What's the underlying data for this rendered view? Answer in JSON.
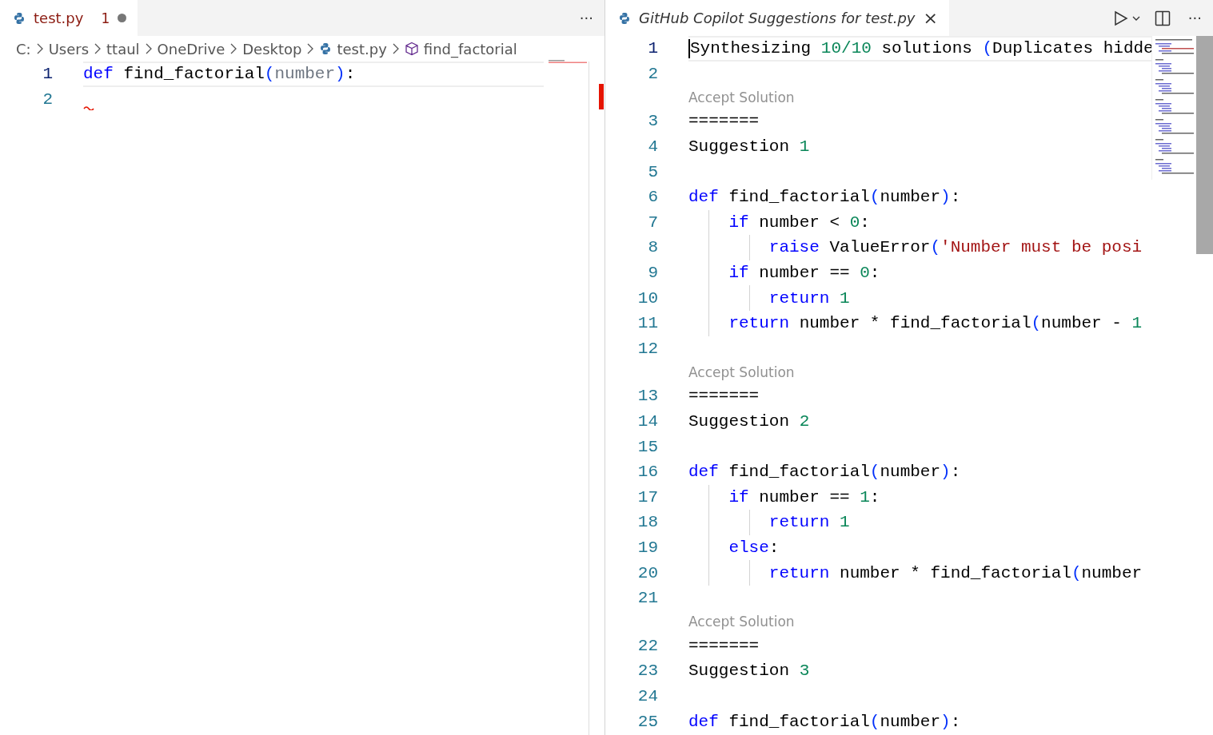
{
  "left_editor": {
    "tab": {
      "label": "test.py",
      "problems": "1",
      "dirty": true,
      "selected": true
    },
    "more_actions": "···",
    "breadcrumbs": [
      {
        "label": "C:",
        "kind": "plain"
      },
      {
        "label": "Users",
        "kind": "plain"
      },
      {
        "label": "ttaul",
        "kind": "plain"
      },
      {
        "label": "OneDrive",
        "kind": "plain"
      },
      {
        "label": "Desktop",
        "kind": "plain"
      },
      {
        "label": "test.py",
        "kind": "file"
      },
      {
        "label": "find_factorial",
        "kind": "symbol"
      }
    ],
    "lines": [
      {
        "number": "1",
        "current": true,
        "error": false,
        "tokens": [
          {
            "text": "def",
            "kind": "kw"
          },
          {
            "text": " find_factorial",
            "kind": "plain"
          },
          {
            "text": "(",
            "kind": "paren"
          },
          {
            "text": "number",
            "kind": "param"
          },
          {
            "text": ")",
            "kind": "paren"
          },
          {
            "text": ":",
            "kind": "plain"
          }
        ]
      },
      {
        "number": "2",
        "current": false,
        "error": true
      }
    ]
  },
  "right_editor": {
    "tab": {
      "label": "GitHub Copilot Suggestions for test.py",
      "close": "×",
      "selected": true
    },
    "more_actions": "···",
    "lines": [
      {
        "kind": "line",
        "number": "1",
        "current": true,
        "tokens": [
          {
            "text": "Synthesizing ",
            "kind": "plain"
          },
          {
            "text": "10/10",
            "kind": "num"
          },
          {
            "text": " solutions ",
            "kind": "plain"
          },
          {
            "text": "(",
            "kind": "paren"
          },
          {
            "text": "Duplicates hidde",
            "kind": "plain"
          }
        ]
      },
      {
        "kind": "line",
        "number": "2",
        "current": false
      },
      {
        "kind": "codelens",
        "label": "Accept Solution"
      },
      {
        "kind": "line",
        "number": "3",
        "current": false,
        "tokens": [
          {
            "text": "=======",
            "kind": "plain"
          }
        ]
      },
      {
        "kind": "line",
        "number": "4",
        "current": false,
        "tokens": [
          {
            "text": "Suggestion ",
            "kind": "plain"
          },
          {
            "text": "1",
            "kind": "num"
          }
        ]
      },
      {
        "kind": "line",
        "number": "5",
        "current": false
      },
      {
        "kind": "line",
        "number": "6",
        "current": false,
        "tokens": [
          {
            "text": "def",
            "kind": "kw"
          },
          {
            "text": " find_factorial",
            "kind": "plain"
          },
          {
            "text": "(",
            "kind": "paren"
          },
          {
            "text": "number",
            "kind": "plain"
          },
          {
            "text": ")",
            "kind": "paren"
          },
          {
            "text": ":",
            "kind": "plain"
          }
        ]
      },
      {
        "kind": "line",
        "number": "7",
        "current": false,
        "tokens": [
          {
            "text": "    if",
            "kind": "kw"
          },
          {
            "text": " number < ",
            "kind": "plain"
          },
          {
            "text": "0",
            "kind": "num"
          },
          {
            "text": ":",
            "kind": "plain"
          }
        ]
      },
      {
        "kind": "line",
        "number": "8",
        "current": false,
        "tokens": [
          {
            "text": "        raise",
            "kind": "kw"
          },
          {
            "text": " ValueError",
            "kind": "plain"
          },
          {
            "text": "(",
            "kind": "paren"
          },
          {
            "text": "'Number must be posi",
            "kind": "str"
          }
        ]
      },
      {
        "kind": "line",
        "number": "9",
        "current": false,
        "tokens": [
          {
            "text": "    if",
            "kind": "kw"
          },
          {
            "text": " number == ",
            "kind": "plain"
          },
          {
            "text": "0",
            "kind": "num"
          },
          {
            "text": ":",
            "kind": "plain"
          }
        ]
      },
      {
        "kind": "line",
        "number": "10",
        "current": false,
        "tokens": [
          {
            "text": "        return",
            "kind": "kw"
          },
          {
            "text": " 1",
            "kind": "num"
          }
        ]
      },
      {
        "kind": "line",
        "number": "11",
        "current": false,
        "tokens": [
          {
            "text": "    return",
            "kind": "kw"
          },
          {
            "text": " number * find_factorial",
            "kind": "plain"
          },
          {
            "text": "(",
            "kind": "paren"
          },
          {
            "text": "number - ",
            "kind": "plain"
          },
          {
            "text": "1",
            "kind": "num"
          }
        ]
      },
      {
        "kind": "line",
        "number": "12",
        "current": false
      },
      {
        "kind": "codelens",
        "label": "Accept Solution"
      },
      {
        "kind": "line",
        "number": "13",
        "current": false,
        "tokens": [
          {
            "text": "=======",
            "kind": "plain"
          }
        ]
      },
      {
        "kind": "line",
        "number": "14",
        "current": false,
        "tokens": [
          {
            "text": "Suggestion ",
            "kind": "plain"
          },
          {
            "text": "2",
            "kind": "num"
          }
        ]
      },
      {
        "kind": "line",
        "number": "15",
        "current": false
      },
      {
        "kind": "line",
        "number": "16",
        "current": false,
        "tokens": [
          {
            "text": "def",
            "kind": "kw"
          },
          {
            "text": " find_factorial",
            "kind": "plain"
          },
          {
            "text": "(",
            "kind": "paren"
          },
          {
            "text": "number",
            "kind": "plain"
          },
          {
            "text": ")",
            "kind": "paren"
          },
          {
            "text": ":",
            "kind": "plain"
          }
        ]
      },
      {
        "kind": "line",
        "number": "17",
        "current": false,
        "tokens": [
          {
            "text": "    if",
            "kind": "kw"
          },
          {
            "text": " number == ",
            "kind": "plain"
          },
          {
            "text": "1",
            "kind": "num"
          },
          {
            "text": ":",
            "kind": "plain"
          }
        ]
      },
      {
        "kind": "line",
        "number": "18",
        "current": false,
        "tokens": [
          {
            "text": "        return",
            "kind": "kw"
          },
          {
            "text": " 1",
            "kind": "num"
          }
        ]
      },
      {
        "kind": "line",
        "number": "19",
        "current": false,
        "tokens": [
          {
            "text": "    else",
            "kind": "kw"
          },
          {
            "text": ":",
            "kind": "plain"
          }
        ]
      },
      {
        "kind": "line",
        "number": "20",
        "current": false,
        "tokens": [
          {
            "text": "        return",
            "kind": "kw"
          },
          {
            "text": " number * find_factorial",
            "kind": "plain"
          },
          {
            "text": "(",
            "kind": "paren"
          },
          {
            "text": "number",
            "kind": "plain"
          }
        ]
      },
      {
        "kind": "line",
        "number": "21",
        "current": false
      },
      {
        "kind": "codelens",
        "label": "Accept Solution"
      },
      {
        "kind": "line",
        "number": "22",
        "current": false,
        "tokens": [
          {
            "text": "=======",
            "kind": "plain"
          }
        ]
      },
      {
        "kind": "line",
        "number": "23",
        "current": false,
        "tokens": [
          {
            "text": "Suggestion ",
            "kind": "plain"
          },
          {
            "text": "3",
            "kind": "num"
          }
        ]
      },
      {
        "kind": "line",
        "number": "24",
        "current": false
      },
      {
        "kind": "line",
        "number": "25",
        "current": false,
        "tokens": [
          {
            "text": "def",
            "kind": "kw"
          },
          {
            "text": " find_factorial",
            "kind": "plain"
          },
          {
            "text": "(",
            "kind": "paren"
          },
          {
            "text": "number",
            "kind": "plain"
          },
          {
            "text": ")",
            "kind": "paren"
          },
          {
            "text": ":",
            "kind": "plain"
          }
        ]
      }
    ]
  }
}
